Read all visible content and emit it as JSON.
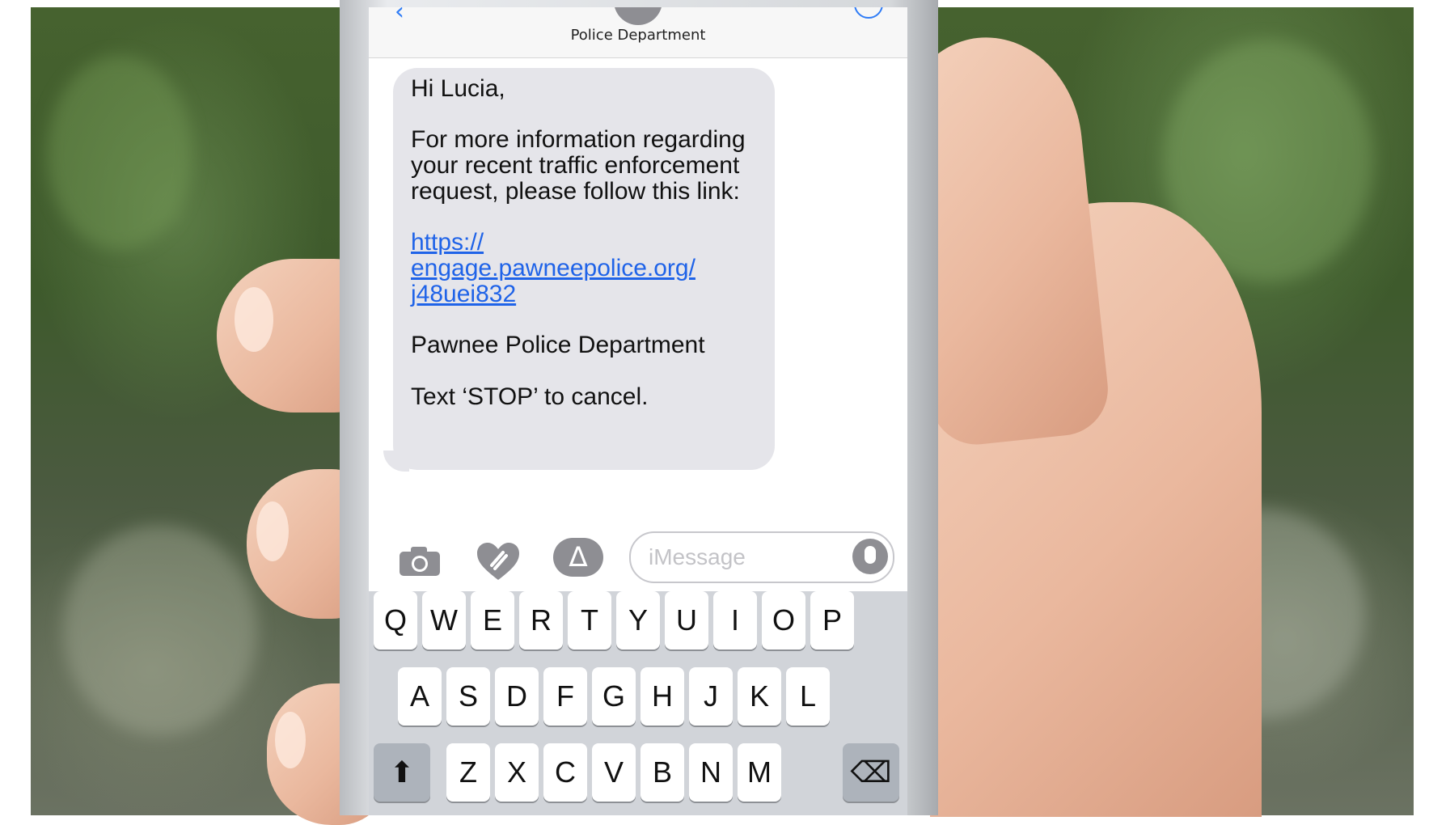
{
  "header": {
    "contact_name": "Police Department",
    "back_icon": "chevron-left-icon",
    "info_icon": "info-icon"
  },
  "message": {
    "greeting": "Hi Lucia,",
    "body_lines": [
      "For more information regarding",
      "your recent traffic enforcement",
      "request, please follow this link:"
    ],
    "link_lines": [
      "https://",
      "engage.pawneepolice.org/",
      "j48uei832"
    ],
    "signature": "Pawnee Police Department",
    "footer": "Text ‘STOP’ to cancel."
  },
  "toolbar": {
    "camera_icon": "camera-icon",
    "digital_touch_icon": "heart-icon",
    "appstore_icon": "appstore-icon",
    "appstore_glyph": "∆",
    "input_placeholder": "iMessage",
    "mic_icon": "microphone-icon"
  },
  "keyboard": {
    "row1": [
      "Q",
      "W",
      "E",
      "R",
      "T",
      "Y",
      "U",
      "I",
      "O",
      "P"
    ],
    "row2": [
      "A",
      "S",
      "D",
      "F",
      "G",
      "H",
      "J",
      "K",
      "L"
    ],
    "row3": [
      "Z",
      "X",
      "C",
      "V",
      "B",
      "N",
      "M"
    ],
    "shift_glyph": "⬆",
    "delete_glyph": "⌫"
  },
  "colors": {
    "bubble": "#e5e5ea",
    "link": "#1f63e8",
    "keyboard": "#d1d4d9"
  }
}
